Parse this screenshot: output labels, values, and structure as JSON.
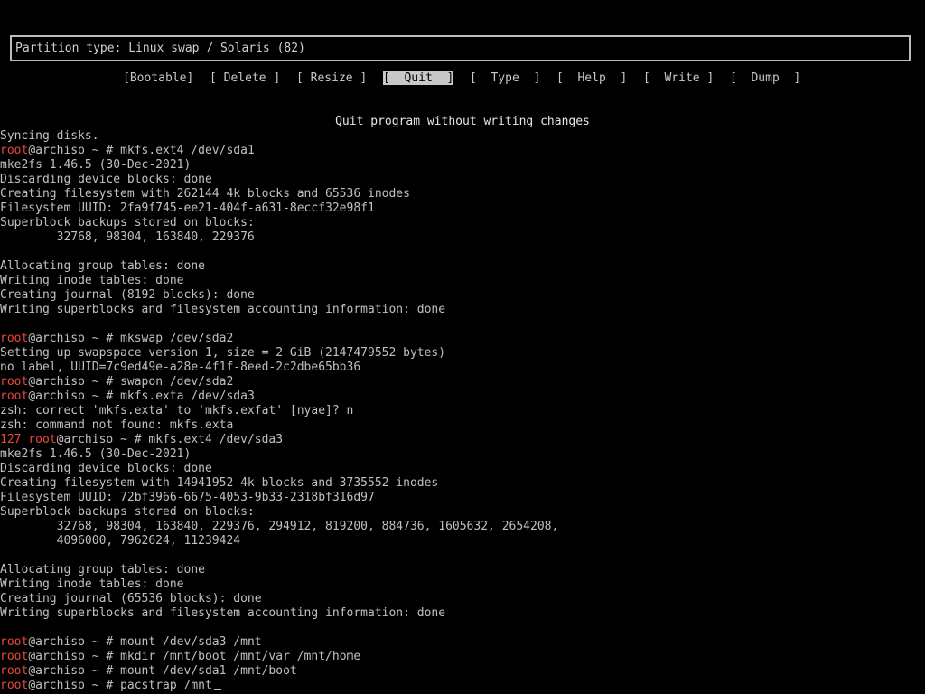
{
  "partition_type": "Partition type: Linux swap / Solaris (82)",
  "menu": [
    {
      "label": "[Bootable]",
      "name": "menu-bootable",
      "selected": false
    },
    {
      "label": "[ Delete ]",
      "name": "menu-delete",
      "selected": false
    },
    {
      "label": "[ Resize ]",
      "name": "menu-resize",
      "selected": false
    },
    {
      "label": "[  Quit  ]",
      "name": "menu-quit",
      "selected": true
    },
    {
      "label": "[  Type  ]",
      "name": "menu-type",
      "selected": false
    },
    {
      "label": "[  Help  ]",
      "name": "menu-help",
      "selected": false
    },
    {
      "label": "[  Write ]",
      "name": "menu-write",
      "selected": false
    },
    {
      "label": "[  Dump  ]",
      "name": "menu-dump",
      "selected": false
    }
  ],
  "status": "Quit program without writing changes",
  "colors": {
    "background": "#000000",
    "text": "#c0c0c0",
    "prompt_user": "#e8473f",
    "highlight": "#c8c8c8"
  },
  "prompt": {
    "user": "root",
    "host": "@archiso ~ # "
  },
  "terminal_lines": [
    {
      "text": "Syncing disks."
    },
    {
      "prompt": true,
      "text": "mkfs.ext4 /dev/sda1"
    },
    {
      "text": "mke2fs 1.46.5 (30-Dec-2021)"
    },
    {
      "text": "Discarding device blocks: done"
    },
    {
      "text": "Creating filesystem with 262144 4k blocks and 65536 inodes"
    },
    {
      "text": "Filesystem UUID: 2fa9f745-ee21-404f-a631-8eccf32e98f1"
    },
    {
      "text": "Superblock backups stored on blocks:"
    },
    {
      "text": "        32768, 98304, 163840, 229376"
    },
    {
      "text": ""
    },
    {
      "text": "Allocating group tables: done"
    },
    {
      "text": "Writing inode tables: done"
    },
    {
      "text": "Creating journal (8192 blocks): done"
    },
    {
      "text": "Writing superblocks and filesystem accounting information: done"
    },
    {
      "text": ""
    },
    {
      "prompt": true,
      "text": "mkswap /dev/sda2"
    },
    {
      "text": "Setting up swapspace version 1, size = 2 GiB (2147479552 bytes)"
    },
    {
      "text": "no label, UUID=7c9ed49e-a28e-4f1f-8eed-2c2dbe65bb36"
    },
    {
      "prompt": true,
      "text": "swapon /dev/sda2"
    },
    {
      "prompt": true,
      "text": "mkfs.exta /dev/sda3"
    },
    {
      "text": "zsh: correct 'mkfs.exta' to 'mkfs.exfat' [nyae]? n"
    },
    {
      "text": "zsh: command not found: mkfs.exta"
    },
    {
      "prompt": true,
      "exit_code": "127 ",
      "text": "mkfs.ext4 /dev/sda3"
    },
    {
      "text": "mke2fs 1.46.5 (30-Dec-2021)"
    },
    {
      "text": "Discarding device blocks: done"
    },
    {
      "text": "Creating filesystem with 14941952 4k blocks and 3735552 inodes"
    },
    {
      "text": "Filesystem UUID: 72bf3966-6675-4053-9b33-2318bf316d97"
    },
    {
      "text": "Superblock backups stored on blocks:"
    },
    {
      "text": "        32768, 98304, 163840, 229376, 294912, 819200, 884736, 1605632, 2654208,"
    },
    {
      "text": "        4096000, 7962624, 11239424"
    },
    {
      "text": ""
    },
    {
      "text": "Allocating group tables: done"
    },
    {
      "text": "Writing inode tables: done"
    },
    {
      "text": "Creating journal (65536 blocks): done"
    },
    {
      "text": "Writing superblocks and filesystem accounting information: done"
    },
    {
      "text": ""
    },
    {
      "prompt": true,
      "text": "mount /dev/sda3 /mnt"
    },
    {
      "prompt": true,
      "text": "mkdir /mnt/boot /mnt/var /mnt/home"
    },
    {
      "prompt": true,
      "text": "mount /dev/sda1 /mnt/boot"
    },
    {
      "prompt": true,
      "text": "pacstrap /mnt",
      "cursor": true
    }
  ]
}
